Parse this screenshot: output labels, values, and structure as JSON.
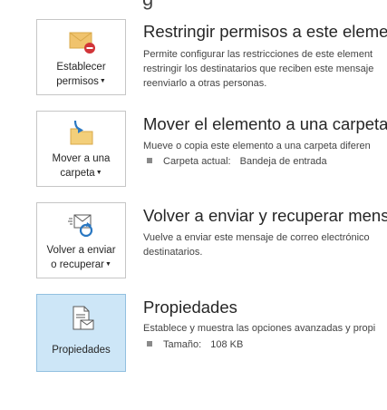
{
  "top_fragment": "g",
  "sections": [
    {
      "button_label_1": "Establecer",
      "button_label_2": "permisos",
      "title": "Restringir permisos a este elemen",
      "desc_line1": "Permite configurar las restricciones de este element",
      "desc_line2": "restringir los destinatarios que reciben este mensaje",
      "desc_line3": "reenviarlo a otras personas.",
      "icon": "restrict-envelope-icon"
    },
    {
      "button_label_1": "Mover a una",
      "button_label_2": "carpeta",
      "title": "Mover el elemento a una carpeta",
      "desc_line1": "Mueve o copia este elemento a una carpeta diferen",
      "detail_label": "Carpeta actual:",
      "detail_value": "Bandeja de entrada",
      "icon": "move-to-folder-icon"
    },
    {
      "button_label_1": "Volver a enviar",
      "button_label_2": "o recuperar",
      "title": "Volver a enviar y recuperar mensa",
      "desc_line1": "Vuelve a enviar este mensaje de correo electrónico",
      "desc_line2": "destinatarios.",
      "icon": "resend-recall-icon"
    },
    {
      "button_label_1": "Propiedades",
      "title": "Propiedades",
      "desc_line1": "Establece y muestra las opciones avanzadas y propi",
      "detail_label": "Tamaño:",
      "detail_value": "108 KB",
      "icon": "properties-icon"
    }
  ],
  "colors": {
    "selected_tile": "#cde6f7",
    "envelope": "#f0c36d",
    "accent_blue": "#2a78c2",
    "restrict_red": "#d13438"
  }
}
